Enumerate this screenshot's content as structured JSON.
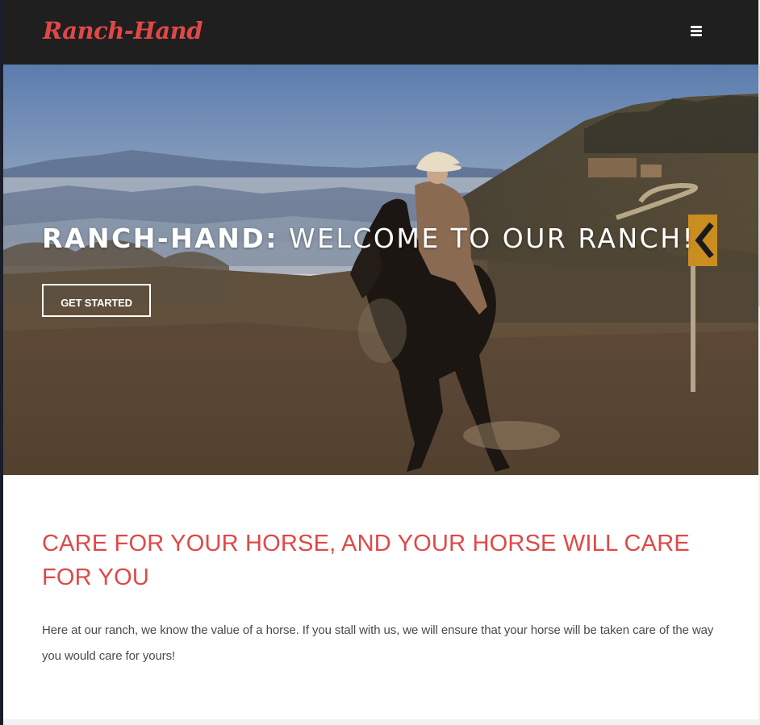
{
  "navbar": {
    "brand": "Ranch-Hand",
    "menu_icon": "hamburger-icon"
  },
  "hero": {
    "title_strong": "RANCH-HAND:",
    "title_rest": " WELCOME TO OUR RANCH!",
    "cta_label": "GET STARTED",
    "image_description_icon": "cowboy-on-horse-photo"
  },
  "content": {
    "heading": "CARE FOR YOUR HORSE, AND YOUR HORSE WILL CARE FOR YOU",
    "body": "Here at our ranch, we know the value of a horse. If you stall with us, we will ensure that your horse will be taken care of the way you would care for yours!"
  },
  "colors": {
    "accent": "#e04848",
    "navbar_bg": "#1f1f1f",
    "text": "#4a4a4a"
  }
}
